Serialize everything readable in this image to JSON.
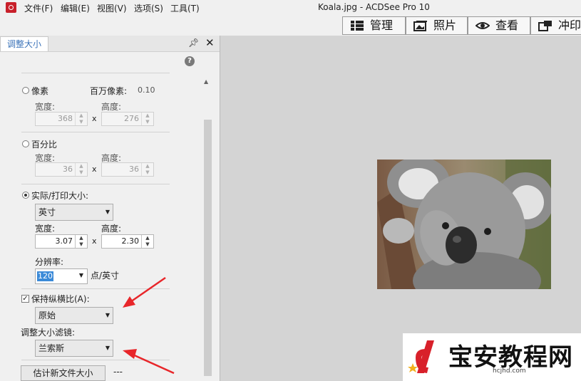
{
  "menu": {
    "items": [
      "文件(F)",
      "编辑(E)",
      "视图(V)",
      "选项(S)",
      "工具(T)"
    ]
  },
  "window": {
    "title": "Koala.jpg - ACDSee Pro 10"
  },
  "mode_tabs": [
    "管理",
    "照片",
    "查看",
    "冲印"
  ],
  "panel": {
    "tab_label": "调整大小",
    "pixels": {
      "label": "像素",
      "megapixels_label": "百万像素:",
      "megapixels_value": "0.10",
      "width_label": "宽度:",
      "width_value": "368",
      "height_label": "高度:",
      "height_value": "276",
      "x": "x"
    },
    "percent": {
      "label": "百分比",
      "width_label": "宽度:",
      "width_value": "36",
      "height_label": "高度:",
      "height_value": "36",
      "x": "x"
    },
    "print": {
      "label": "实际/打印大小:",
      "unit": "英寸",
      "width_label": "宽度:",
      "width_value": "3.07",
      "height_label": "高度:",
      "height_value": "2.30",
      "x": "x",
      "resolution_label": "分辨率:",
      "resolution_value": "120",
      "resolution_unit": "点/英寸"
    },
    "keep_ratio_label": "保持纵横比(A):",
    "keep_ratio_checked": true,
    "ratio_value": "原始",
    "filter_label": "调整大小滤镜:",
    "filter_value": "兰索斯",
    "estimate_button": "估计新文件大小",
    "estimate_result": "---"
  },
  "watermark": {
    "title": "宝安教程网",
    "url": "hcjhd.com"
  },
  "colors": {
    "accent": "#3b73b9",
    "arrow": "#e8262a",
    "app_icon": "#c8202a"
  }
}
